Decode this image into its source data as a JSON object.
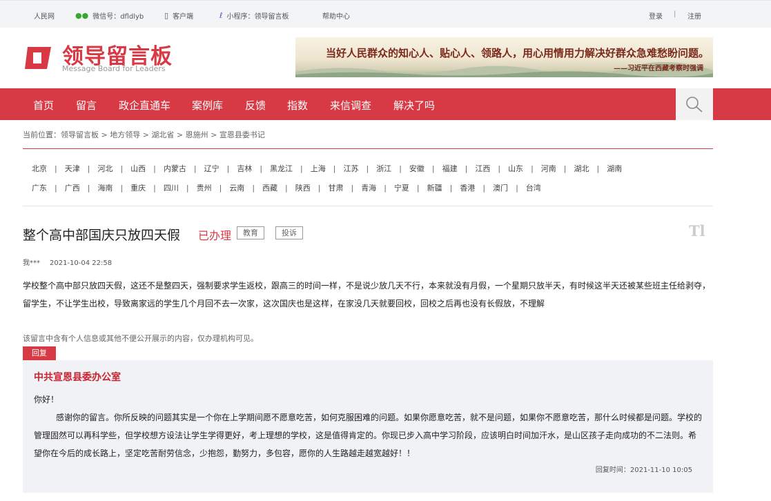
{
  "topbar": {
    "people": "人民网",
    "wechat": "微信号：dfldlyb",
    "client": "客户端",
    "miniprogram": "小程序：领导留言板",
    "help": "帮助中心",
    "login": "登录",
    "separator": "|",
    "register": "注册"
  },
  "header": {
    "logo_title": "领导留言板",
    "logo_subtitle": "Message Board for Leaders",
    "banner_slogan": "当好人民群众的知心人、贴心人、领路人，用心用情用力解决好群众急难愁盼问题。",
    "banner_attribution": "——习近平在西藏考察时强调"
  },
  "nav": {
    "items": [
      "首页",
      "留言",
      "政企直通车",
      "案例库",
      "反馈",
      "指数",
      "来信调查",
      "解决了吗"
    ]
  },
  "breadcrumb": "当前位置：领导留言板 > 地方领导 > 湖北省 > 恩施州 > 宣恩县委书记",
  "provinces": {
    "row1": [
      "北京",
      "天津",
      "河北",
      "山西",
      "内蒙古",
      "辽宁",
      "吉林",
      "黑龙江",
      "上海",
      "江苏",
      "浙江",
      "安徽",
      "福建",
      "江西",
      "山东",
      "河南",
      "湖北",
      "湖南"
    ],
    "row2": [
      "广东",
      "广西",
      "海南",
      "重庆",
      "四川",
      "贵州",
      "云南",
      "西藏",
      "陕西",
      "甘肃",
      "青海",
      "宁夏",
      "新疆",
      "香港",
      "澳门",
      "台湾"
    ]
  },
  "message": {
    "title": "整个高中部国庆只放四天假",
    "status": "已办理",
    "tags": [
      "教育",
      "投诉"
    ],
    "font_toggle": "Tl",
    "author": "我***",
    "date": "2021-10-04 22:58",
    "content": "学校整个高中部只放四天假，这还不是整四天，强制要求学生返校，跟高三的时间一样，不是说少放几天不行，本来就没有月假，一个星期只放半天，有时候这半天还被某些班主任给剥夺，留学生，不让学生出校，导致离家远的学生几个月回不去一次家，这次国庆也是这样，在家没几天就要回校，回校之后再也没有长假放，不理解",
    "privacy_notice": "该留言中含有个人信息或其他不便公开展示的内容，仅办理机构可见。",
    "reply_label": "回复"
  },
  "reply": {
    "org": "中共宣恩县委办公室",
    "greeting": "你好！",
    "content": "感谢你的留言。你所反映的问题其实是一个你在上学期间愿不愿意吃苦，如何克服困难的问题。如果你愿意吃苦，就不是问题，如果你不愿意吃苦，那什么时候都是问题。学校的管理固然可以再科学些，但学校想方设法让学生学得更好，考上理想的学校，这是值得肯定的。你现已步入高中学习阶段，应该明白时间加汗水，是山区孩子走向成功的不二法则。希望你在今后的成长路上，坚定吃苦耐劳信念，少抱怨，勤努力，多包容，愿你的人生路越走越宽越好！！",
    "time": "回复时间：2021-11-10 10:05"
  },
  "colors": {
    "brand_red": "#d83a45",
    "reply_bg": "#f1f2f5"
  },
  "icons": [
    "wechat-icon",
    "phone-icon",
    "miniprogram-icon",
    "search-icon",
    "logo-icon"
  ]
}
